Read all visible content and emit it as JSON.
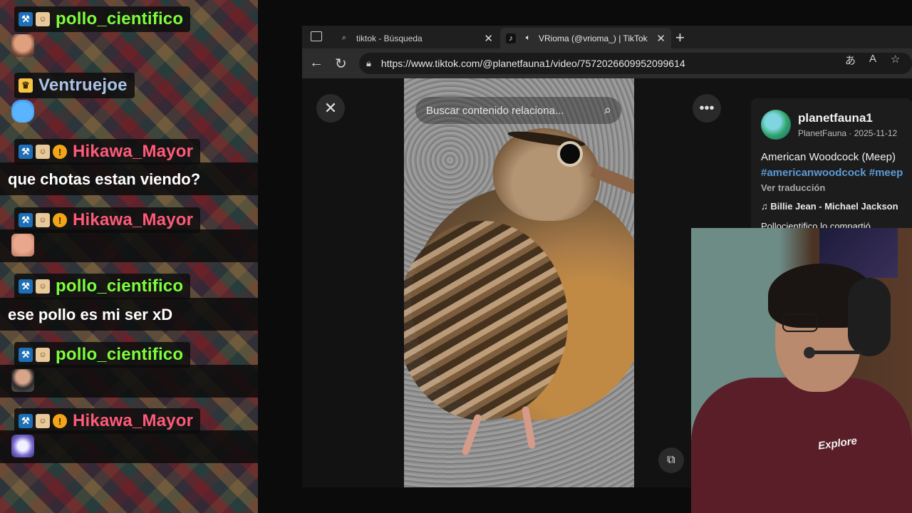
{
  "chat": {
    "messages": [
      {
        "username": "pollo_cientifico",
        "color": "#7cff3b",
        "badges": [
          "mod",
          "sub"
        ],
        "text": "",
        "emote": "avatar-emote"
      },
      {
        "username": "Ventruejoe",
        "color": "#a9c3e8",
        "badges": [
          "crown"
        ],
        "text": "",
        "emote": "blue-creature-emote"
      },
      {
        "username": "Hikawa_Mayor",
        "color": "#ff5a7a",
        "badges": [
          "mod",
          "sub",
          "bits"
        ],
        "text": "que chotas estan viendo?",
        "emote": ""
      },
      {
        "username": "Hikawa_Mayor",
        "color": "#ff5a7a",
        "badges": [
          "mod",
          "sub",
          "bits"
        ],
        "text": "",
        "emote": "face-emote"
      },
      {
        "username": "pollo_cientifico",
        "color": "#7cff3b",
        "badges": [
          "mod",
          "sub"
        ],
        "text": "ese pollo es mi ser xD",
        "emote": ""
      },
      {
        "username": "pollo_cientifico",
        "color": "#7cff3b",
        "badges": [
          "mod",
          "sub"
        ],
        "text": "",
        "emote": "bearded-man-emote"
      },
      {
        "username": "Hikawa_Mayor",
        "color": "#ff5a7a",
        "badges": [
          "mod",
          "sub",
          "bits"
        ],
        "text": "",
        "emote": "cat-emote"
      }
    ],
    "badge_glyphs": {
      "mod": "⚒",
      "sub": "☺",
      "bits": "!",
      "crown": "♛"
    }
  },
  "browser": {
    "tabs": [
      {
        "label": "tiktok - Búsqueda",
        "icon": "search-icon",
        "active": false
      },
      {
        "label": "VRioma (@vrioma_) | TikTok",
        "icon": "tiktok-icon",
        "active": true
      }
    ],
    "url": "https://www.tiktok.com/@planetfauna1/video/7572026609952099614"
  },
  "tiktok": {
    "search_placeholder": "Buscar contenido relaciona...",
    "username": "planetfauna1",
    "display_info": "PlanetFauna · 2025-11-12",
    "title": "American Woodcock (Meep)",
    "tags": "#americanwoodcock #meep",
    "translate": "Ver traducción",
    "music": "♫  Billie Jean - Michael Jackson",
    "shared": "Pollocientifico lo compartió"
  },
  "webcam": {
    "shirt_logo": "Explore"
  }
}
